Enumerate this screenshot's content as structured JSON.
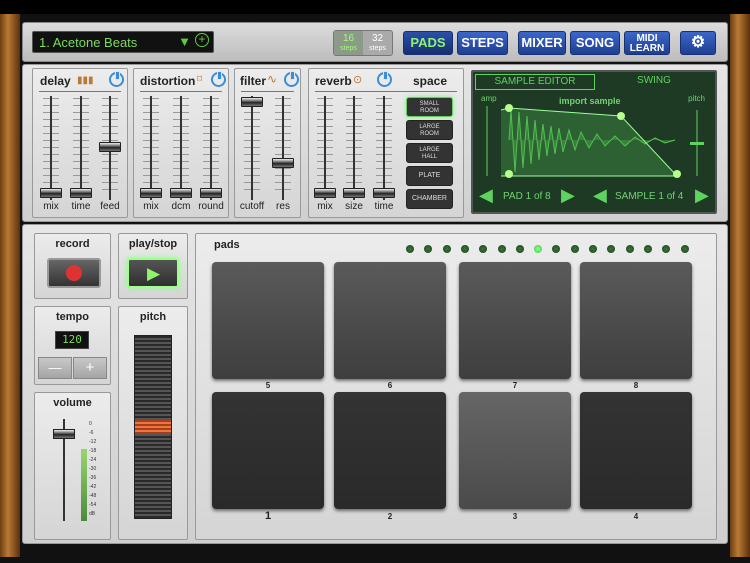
{
  "top": {
    "preset": "1. Acetone Beats",
    "steps16": "16",
    "steps32": "32",
    "steps_word": "steps",
    "pads": "PADS",
    "steps": "STEPS",
    "mixer": "MIXER",
    "song": "SONG",
    "midi1": "MIDI",
    "midi2": "LEARN"
  },
  "delay": {
    "title": "delay",
    "labels": [
      "mix",
      "time",
      "feed"
    ]
  },
  "distortion": {
    "title": "distortion",
    "labels": [
      "mix",
      "dcm",
      "round"
    ]
  },
  "filter": {
    "title": "filter",
    "labels": [
      "cutoff",
      "res"
    ]
  },
  "reverb": {
    "title": "reverb",
    "space": "space",
    "labels": [
      "mix",
      "size",
      "time"
    ],
    "spaces": [
      [
        "SMALL",
        "ROOM"
      ],
      [
        "LARGE",
        "ROOM"
      ],
      [
        "LARGE",
        "HALL"
      ],
      [
        "PLATE",
        ""
      ],
      [
        "CHAMBER",
        ""
      ]
    ]
  },
  "sampler": {
    "tab1": "SAMPLE EDITOR",
    "tab2": "SWING",
    "import": "import sample",
    "amp": "amp",
    "pitch": "pitch",
    "pad": "PAD 1 of 8",
    "sample": "SAMPLE 1 of 4"
  },
  "record": {
    "title": "record"
  },
  "play": {
    "title": "play/stop"
  },
  "tempo": {
    "title": "tempo",
    "value": "120",
    "minus": "—",
    "plus": "+"
  },
  "volume": {
    "title": "volume",
    "scale": [
      "0",
      "-6",
      "-12",
      "-18",
      "-24",
      "-30",
      "-36",
      "-42",
      "-48",
      "-54",
      "dB"
    ]
  },
  "pitch": {
    "title": "pitch"
  },
  "pads": {
    "title": "pads",
    "top": [
      "5",
      "6",
      "7",
      "8"
    ],
    "bottom": [
      "1",
      "2",
      "3",
      "4"
    ]
  }
}
